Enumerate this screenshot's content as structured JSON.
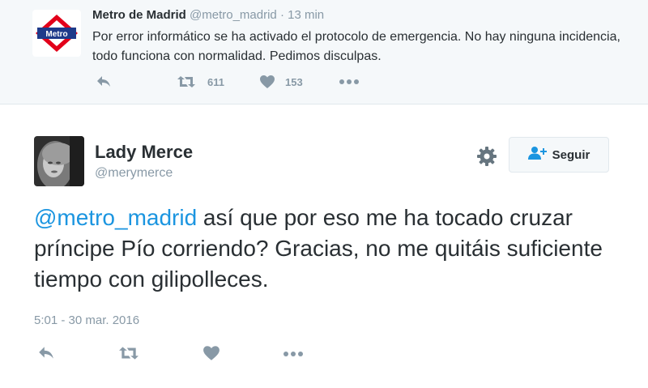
{
  "parent_tweet": {
    "logo_text": "Metro",
    "name": "Metro de Madrid",
    "handle": "@metro_madrid",
    "separator": "·",
    "time": "13 min",
    "text": "Por error informático se ha activado el protocolo de emergencia. No hay ninguna incidencia, todo funciona con normalidad. Pedimos disculpas.",
    "retweets": "611",
    "likes": "153"
  },
  "main_tweet": {
    "name": "Lady Merce",
    "handle": "@merymerce",
    "follow_label": "Seguir",
    "mention": "@metro_madrid",
    "text": " así que por eso me ha tocado cruzar príncipe Pío corriendo? Gracias, no me quitáis suficiente tiempo con gilipolleces.",
    "timestamp": "5:01 - 30 mar. 2016"
  },
  "colors": {
    "metro_red": "#e2001a",
    "metro_blue": "#1e3a8a",
    "link_blue": "#1b95e0",
    "icon_gray": "#8899a6"
  }
}
